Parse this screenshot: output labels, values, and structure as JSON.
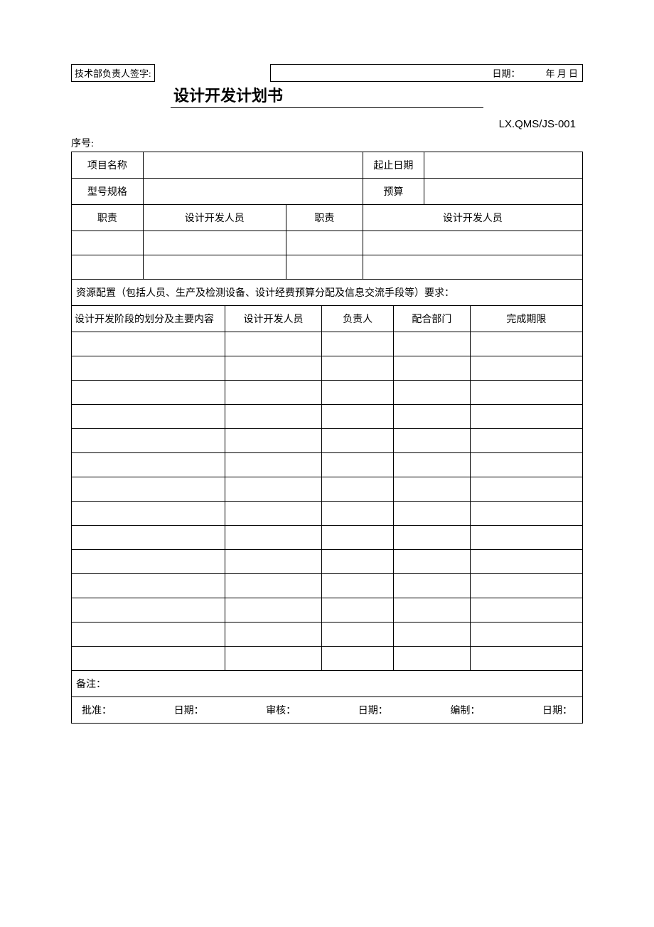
{
  "header": {
    "signature_label": "技术部负责人签字:",
    "date_label": "日期：",
    "date_format": "年 月 日"
  },
  "title": "设计开发计划书",
  "doc_code": "LX.QMS/JS-001",
  "seq_label": "序号:",
  "row1": {
    "project_name_label": "项目名称",
    "project_name_value": "",
    "date_range_label": "起止日期",
    "date_range_value": ""
  },
  "row2": {
    "model_label": "型号规格",
    "model_value": "",
    "budget_label": "预算",
    "budget_value": ""
  },
  "row3": {
    "duty_label1": "职责",
    "dev_person_label1": "设计开发人员",
    "duty_label2": "职责",
    "dev_person_label2": "设计开发人员"
  },
  "resource_text": "资源配置（包括人员、生产及检测设备、设计经费预算分配及信息交流手段等）要求：",
  "stage_headers": {
    "stage": "设计开发阶段的划分及主要内容",
    "person": "设计开发人员",
    "responsible": "负责人",
    "dept": "配合部门",
    "deadline": "完成期限"
  },
  "stage_rows_count": 14,
  "remark_label": "备注：",
  "footer": {
    "approve": "批准：",
    "approve_date": "日期：",
    "review": "审核：",
    "review_date": "日期：",
    "compile": "编制：",
    "compile_date": "日期："
  }
}
